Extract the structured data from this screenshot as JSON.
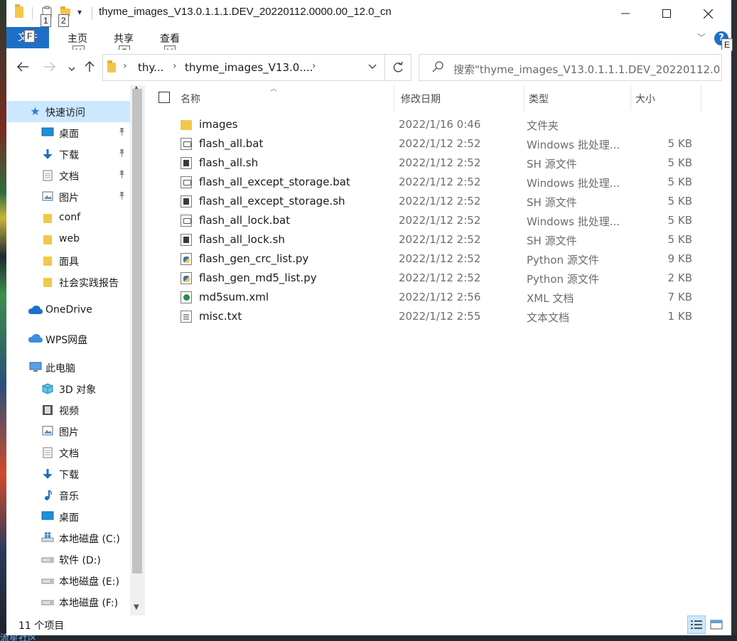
{
  "window": {
    "title": "thyme_images_V13.0.1.1.1.DEV_20220112.0000.00_12.0_cn",
    "minimize_icon": "minimize-icon",
    "maximize_icon": "maximize-icon",
    "close_icon": "close-icon"
  },
  "quick_access_toolbar": {
    "keytip_1": "1",
    "keytip_2": "2",
    "dropdown_glyph": "▾"
  },
  "ribbon": {
    "file_tab": "文件",
    "file_keytip": "F",
    "tabs": [
      {
        "label": "主页",
        "keytip": "H"
      },
      {
        "label": "共享",
        "keytip": "S"
      },
      {
        "label": "查看",
        "keytip": "V"
      }
    ],
    "help": "?",
    "expand_keytip": "E"
  },
  "address_bar": {
    "crumbs": [
      "thy...",
      "thyme_images_V13.0...."
    ],
    "search_placeholder": "搜索\"thyme_images_V13.0.1.1.1.DEV_20220112.00..."
  },
  "navigation": {
    "quick_access": "快速访问",
    "quick_items": [
      {
        "label": "桌面",
        "icon": "desktop-icon",
        "pinned": true
      },
      {
        "label": "下载",
        "icon": "download-icon",
        "pinned": true
      },
      {
        "label": "文档",
        "icon": "document-icon",
        "pinned": true
      },
      {
        "label": "图片",
        "icon": "picture-icon",
        "pinned": true
      },
      {
        "label": "conf",
        "icon": "folder-icon",
        "pinned": false
      },
      {
        "label": "web",
        "icon": "folder-icon",
        "pinned": false
      },
      {
        "label": "面具",
        "icon": "folder-icon",
        "pinned": false
      },
      {
        "label": "社会实践报告",
        "icon": "folder-icon",
        "pinned": false
      }
    ],
    "onedrive": "OneDrive",
    "wps": "WPS网盘",
    "this_pc": "此电脑",
    "pc_items": [
      {
        "label": "3D 对象",
        "icon": "cube-icon"
      },
      {
        "label": "视频",
        "icon": "video-icon"
      },
      {
        "label": "图片",
        "icon": "picture-icon"
      },
      {
        "label": "文档",
        "icon": "document-icon"
      },
      {
        "label": "下载",
        "icon": "download-icon"
      },
      {
        "label": "音乐",
        "icon": "music-icon"
      },
      {
        "label": "桌面",
        "icon": "desktop-icon"
      },
      {
        "label": "本地磁盘 (C:)",
        "icon": "windows-drive-icon"
      },
      {
        "label": "软件 (D:)",
        "icon": "drive-icon"
      },
      {
        "label": "本地磁盘 (E:)",
        "icon": "drive-icon"
      },
      {
        "label": "本地磁盘 (F:)",
        "icon": "drive-icon"
      }
    ]
  },
  "columns": {
    "name": "名称",
    "modified": "修改日期",
    "type": "类型",
    "size": "大小"
  },
  "files": [
    {
      "name": "images",
      "modified": "2022/1/16 0:46",
      "type": "文件夹",
      "size": "",
      "icon": "folder"
    },
    {
      "name": "flash_all.bat",
      "modified": "2022/1/12 2:52",
      "type": "Windows 批处理...",
      "size": "5 KB",
      "icon": "bat"
    },
    {
      "name": "flash_all.sh",
      "modified": "2022/1/12 2:52",
      "type": "SH 源文件",
      "size": "5 KB",
      "icon": "sh"
    },
    {
      "name": "flash_all_except_storage.bat",
      "modified": "2022/1/12 2:52",
      "type": "Windows 批处理...",
      "size": "5 KB",
      "icon": "bat"
    },
    {
      "name": "flash_all_except_storage.sh",
      "modified": "2022/1/12 2:52",
      "type": "SH 源文件",
      "size": "5 KB",
      "icon": "sh"
    },
    {
      "name": "flash_all_lock.bat",
      "modified": "2022/1/12 2:52",
      "type": "Windows 批处理...",
      "size": "5 KB",
      "icon": "bat"
    },
    {
      "name": "flash_all_lock.sh",
      "modified": "2022/1/12 2:52",
      "type": "SH 源文件",
      "size": "5 KB",
      "icon": "sh"
    },
    {
      "name": "flash_gen_crc_list.py",
      "modified": "2022/1/12 2:52",
      "type": "Python 源文件",
      "size": "9 KB",
      "icon": "py"
    },
    {
      "name": "flash_gen_md5_list.py",
      "modified": "2022/1/12 2:52",
      "type": "Python 源文件",
      "size": "2 KB",
      "icon": "py"
    },
    {
      "name": "md5sum.xml",
      "modified": "2022/1/12 2:56",
      "type": "XML 文档",
      "size": "7 KB",
      "icon": "xml"
    },
    {
      "name": "misc.txt",
      "modified": "2022/1/12 2:55",
      "type": "文本文档",
      "size": "1 KB",
      "icon": "doc"
    }
  ],
  "status": {
    "item_count": "11 个项目"
  },
  "desktop": {
    "bottom_text": "流星社区"
  },
  "colors": {
    "accent": "#1e6fc7",
    "selection": "#cce8ff",
    "folder": "#f2c84b"
  }
}
